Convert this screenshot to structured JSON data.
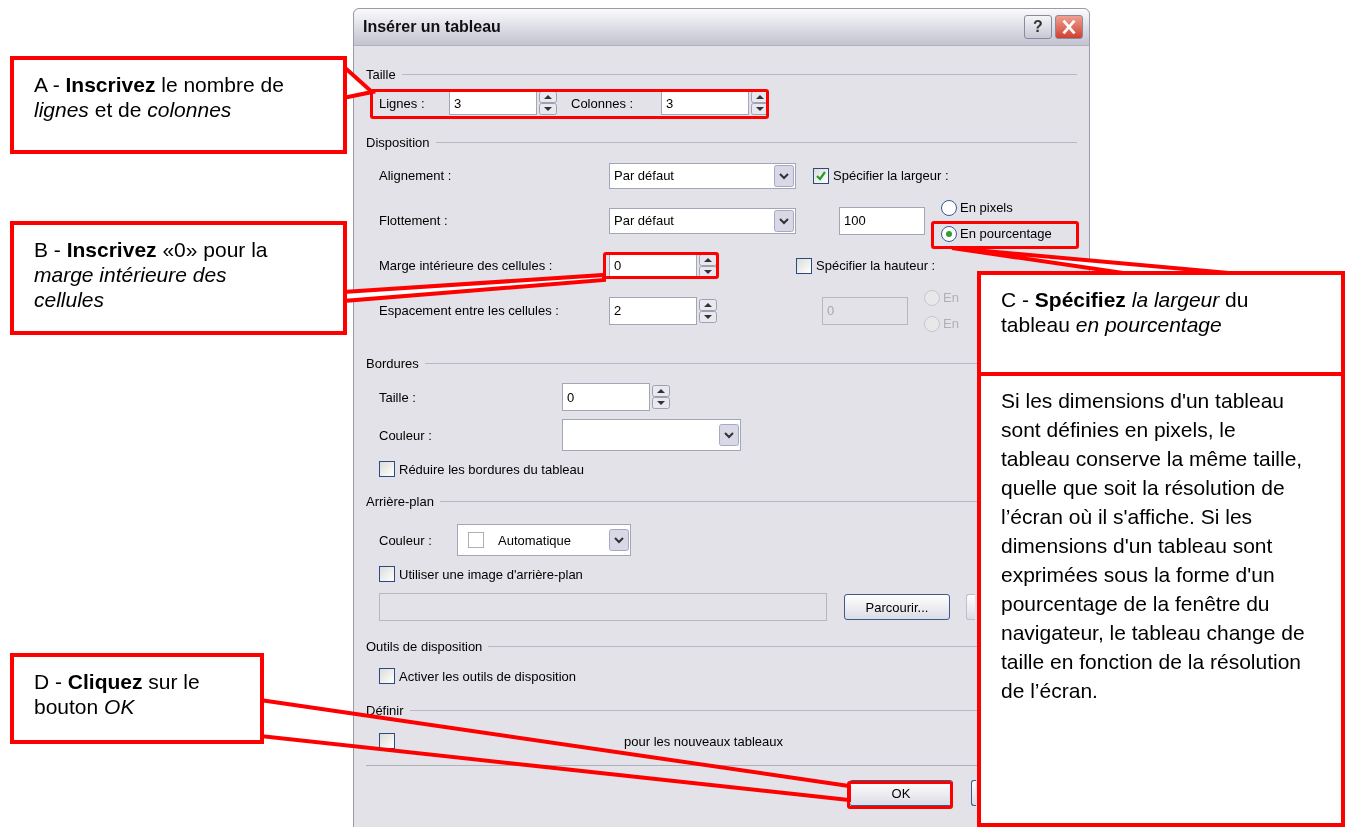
{
  "window": {
    "title": "Insérer un tableau",
    "help": "?"
  },
  "size": {
    "label": "Taille",
    "rows": {
      "label": "Lignes :",
      "value": "3"
    },
    "columns": {
      "label": "Colonnes :",
      "value": "3"
    }
  },
  "layout": {
    "label": "Disposition",
    "alignment": {
      "label": "Alignement :",
      "value": "Par défaut"
    },
    "float": {
      "label": "Flottement :",
      "value": "Par défaut"
    },
    "padding": {
      "label": "Marge intérieure des cellules :",
      "value": "0"
    },
    "spacing": {
      "label": "Espacement entre les cellules :",
      "value": "2"
    },
    "width": {
      "label": "Spécifier la largeur :",
      "checked": true,
      "value": "100",
      "disabled": false,
      "units": [
        {
          "label": "En pixels",
          "selected": false
        },
        {
          "label": "En pourcentage",
          "selected": true
        }
      ]
    },
    "height": {
      "label": "Spécifier la hauteur :",
      "checked": false,
      "value": "0",
      "disabled": true,
      "units": [
        {
          "label": "En",
          "selected": false
        },
        {
          "label": "En",
          "selected": false
        }
      ]
    }
  },
  "borders": {
    "label": "Bordures",
    "size": {
      "label": "Taille :",
      "value": "0"
    },
    "color": {
      "label": "Couleur :"
    },
    "collapse": {
      "label": "Réduire les bordures du tableau",
      "checked": false
    }
  },
  "background": {
    "label": "Arrière-plan",
    "color": {
      "label": "Couleur :",
      "value": "Automatique"
    },
    "use_image": {
      "label": "Utiliser une image d'arrière-plan",
      "checked": false
    },
    "browse": "Parcourir..."
  },
  "layout_tools": {
    "label": "Outils de disposition",
    "enable": {
      "label": "Activer les outils de disposition",
      "checked": false
    }
  },
  "define": {
    "label": "Définir",
    "default": {
      "label": "pour les nouveaux tableaux",
      "checked": false
    }
  },
  "buttons": [
    "OK"
  ],
  "callouts": [
    {
      "text": "A - **Inscrivez** le nombre de *lignes* et de *colonnes*"
    },
    {
      "text": "B - **Inscrivez** «0» pour la *marge intérieure des cellules*"
    },
    {
      "text": "C - **Spécifiez** *la largeur* du tableau *en pourcentage*"
    },
    {
      "text": "D - **Cliquez** sur le bouton *OK*"
    }
  ],
  "note": "Si les dimensions d'un tableau sont définies en pixels, le tableau conserve la même taille, quelle que soit la résolution de l’écran où il s'affiche. Si les dimensions d'un tableau sont exprimées sous la forme d'un pourcentage de la fenêtre du navigateur, le tableau change de taille en fonction de la résolution de l’écran."
}
